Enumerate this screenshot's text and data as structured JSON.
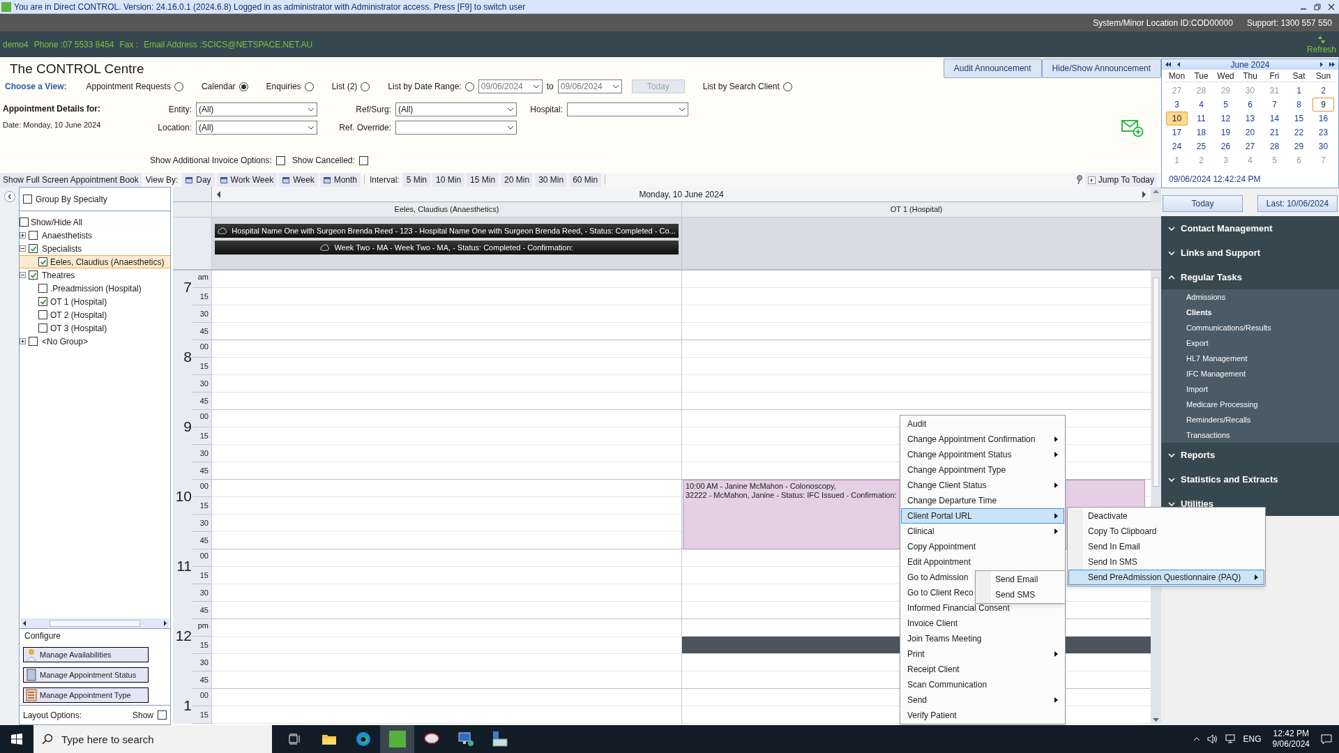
{
  "titlebar": {
    "text": "You are in Direct CONTROL. Version: 24.16.0.1 (2024.6.8) Logged in as administrator with Administrator access. Press [F9] to switch user"
  },
  "system_bar": {
    "location": "System/Minor Location ID:COD00000",
    "support": "Support: 1300 557 550"
  },
  "info_bar": {
    "parts": [
      "demo4",
      "Phone :07 5533 8454",
      "Fax :",
      "Email Address :SCICS@NETSPACE.NET.AU"
    ],
    "refresh": "Refresh"
  },
  "header": {
    "title": "The CONTROL Centre",
    "buttons": [
      "Audit Announcement",
      "Hide/Show Announcement"
    ]
  },
  "view_chooser": {
    "label": "Choose a View:",
    "options": [
      {
        "kind": "radio",
        "label": "Appointment Requests",
        "selected": false
      },
      {
        "kind": "radio",
        "label": "Calendar",
        "selected": true
      },
      {
        "kind": "radio",
        "label": "Enquiries",
        "selected": false
      },
      {
        "kind": "radio",
        "label": "List (2)",
        "selected": false
      },
      {
        "kind": "date_range",
        "label": "List by Date Range:",
        "selected": false,
        "from": "09/06/2024",
        "to_label": "to",
        "to": "09/06/2024",
        "today": "Today"
      },
      {
        "kind": "radio",
        "label": "List by Search Client",
        "selected": false
      }
    ]
  },
  "details": {
    "heading": "Appointment Details for:",
    "date": "Date: Monday, 10 June 2024",
    "filters": [
      {
        "label": "Entity:",
        "value": "(All)"
      },
      {
        "label": "Ref/Surg:",
        "value": "(All)"
      },
      {
        "label": "Hospital:"
      },
      {
        "label": "Location:",
        "value": "(All)"
      },
      {
        "label": "Ref. Override:"
      }
    ]
  },
  "options": [
    {
      "label": "Show Additional Invoice Options:",
      "checked": false
    },
    {
      "label": "Show Cancelled:",
      "checked": false
    }
  ],
  "toolbar": {
    "full_screen": "Show Full Screen Appointment Book",
    "view_by_label": "View By:",
    "views": [
      "Day",
      "Work Week",
      "Week",
      "Month"
    ],
    "interval_label": "Interval:",
    "intervals": [
      "5 Min",
      "10 Min",
      "15 Min",
      "20 Min",
      "30 Min",
      "60 Min"
    ],
    "jump": "Jump To Today"
  },
  "resource_panel": {
    "group_by": {
      "label": "Group By Specialty",
      "checked": false
    },
    "show_hide_all": {
      "label": "Show/Hide All",
      "checked": false
    },
    "tree": [
      {
        "label": "Anaesthetists",
        "checked": false,
        "expanded": false,
        "selected": false
      },
      {
        "label": "Specialists",
        "checked": true,
        "expanded": true,
        "selected": false,
        "children": [
          {
            "label": "Eeles, Claudius (Anaesthetics)",
            "checked": true,
            "selected": true
          }
        ]
      },
      {
        "label": "Theatres",
        "checked": true,
        "expanded": true,
        "selected": false,
        "children": [
          {
            "label": ".Preadmission (Hospital)",
            "checked": false,
            "selected": false
          },
          {
            "label": "OT 1 (Hospital)",
            "checked": true,
            "selected": false
          },
          {
            "label": "OT 2 (Hospital)",
            "checked": false,
            "selected": false
          },
          {
            "label": "OT 3 (Hospital)",
            "checked": false,
            "selected": false
          }
        ]
      },
      {
        "label": "<No Group>",
        "checked": false,
        "expanded": false,
        "selected": false
      }
    ]
  },
  "configure": {
    "title": "Configure",
    "buttons": [
      "Manage Availabilities",
      "Manage Appointment Status",
      "Manage Appointment Type"
    ],
    "layout_options": "Layout Options:",
    "show": {
      "label": "Show",
      "checked": false
    }
  },
  "calendar": {
    "date": "Monday, 10 June 2024",
    "columns": [
      {
        "name": "Eeles, Claudius (Anaesthetics)",
        "all_day": [
          "Hospital Name One with Surgeon Brenda Reed - 123 - Hospital Name One with Surgeon Brenda Reed,  - Status: Completed - Co...",
          "Week Two - MA - Week Two - MA,  - Status: Completed - Confirmation:"
        ]
      },
      {
        "name": "OT 1 (Hospital)",
        "appointments": [
          {
            "lines": [
              "10:00 AM - Janine McMahon - Colonoscopy,",
              "32222 - McMahon, Janine - Status: IFC Issued - Confirmation:"
            ]
          }
        ]
      }
    ],
    "hours": [
      {
        "hour": "7",
        "first": "am",
        "minutes": [
          "15",
          "30",
          "45"
        ]
      },
      {
        "hour": "8",
        "first": "00",
        "minutes": [
          "15",
          "30",
          "45"
        ]
      },
      {
        "hour": "9",
        "first": "00",
        "minutes": [
          "15",
          "30",
          "45"
        ]
      },
      {
        "hour": "10",
        "first": "00",
        "minutes": [
          "15",
          "30",
          "45"
        ]
      },
      {
        "hour": "11",
        "first": "00",
        "minutes": [
          "15",
          "30",
          "45"
        ]
      },
      {
        "hour": "12",
        "first": "pm",
        "minutes": [
          "15",
          "30",
          "45"
        ]
      },
      {
        "hour": "1",
        "first": "00",
        "minutes": [
          "15"
        ]
      }
    ]
  },
  "mini_calendar": {
    "month": "June 2024",
    "weekdays": [
      "Mon",
      "Tue",
      "Wed",
      "Thu",
      "Fri",
      "Sat",
      "Sun"
    ],
    "days": [
      {
        "d": "27",
        "muted": true,
        "selected": false,
        "today": false
      },
      {
        "d": "28",
        "muted": true,
        "selected": false,
        "today": false
      },
      {
        "d": "29",
        "muted": true,
        "selected": false,
        "today": false
      },
      {
        "d": "30",
        "muted": true,
        "selected": false,
        "today": false
      },
      {
        "d": "31",
        "muted": true,
        "selected": false,
        "today": false
      },
      {
        "d": "1",
        "muted": false,
        "selected": false,
        "today": false
      },
      {
        "d": "2",
        "muted": false,
        "selected": false,
        "today": false
      },
      {
        "d": "3",
        "muted": false,
        "selected": false,
        "today": false
      },
      {
        "d": "4",
        "muted": false,
        "selected": false,
        "today": false
      },
      {
        "d": "5",
        "muted": false,
        "selected": false,
        "today": false
      },
      {
        "d": "6",
        "muted": false,
        "selected": false,
        "today": false
      },
      {
        "d": "7",
        "muted": false,
        "selected": false,
        "today": false
      },
      {
        "d": "8",
        "muted": false,
        "selected": false,
        "today": false
      },
      {
        "d": "9",
        "muted": false,
        "selected": false,
        "today": true
      },
      {
        "d": "10",
        "muted": false,
        "selected": true,
        "today": false
      },
      {
        "d": "11",
        "muted": false,
        "selected": false,
        "today": false
      },
      {
        "d": "12",
        "muted": false,
        "selected": false,
        "today": false
      },
      {
        "d": "13",
        "muted": false,
        "selected": false,
        "today": false
      },
      {
        "d": "14",
        "muted": false,
        "selected": false,
        "today": false
      },
      {
        "d": "15",
        "muted": false,
        "selected": false,
        "today": false
      },
      {
        "d": "16",
        "muted": false,
        "selected": false,
        "today": false
      },
      {
        "d": "17",
        "muted": false,
        "selected": false,
        "today": false
      },
      {
        "d": "18",
        "muted": false,
        "selected": false,
        "today": false
      },
      {
        "d": "19",
        "muted": false,
        "selected": false,
        "today": false
      },
      {
        "d": "20",
        "muted": false,
        "selected": false,
        "today": false
      },
      {
        "d": "21",
        "muted": false,
        "selected": false,
        "today": false
      },
      {
        "d": "22",
        "muted": false,
        "selected": false,
        "today": false
      },
      {
        "d": "23",
        "muted": false,
        "selected": false,
        "today": false
      },
      {
        "d": "24",
        "muted": false,
        "selected": false,
        "today": false
      },
      {
        "d": "25",
        "muted": false,
        "selected": false,
        "today": false
      },
      {
        "d": "26",
        "muted": false,
        "selected": false,
        "today": false
      },
      {
        "d": "27",
        "muted": false,
        "selected": false,
        "today": false
      },
      {
        "d": "28",
        "muted": false,
        "selected": false,
        "today": false
      },
      {
        "d": "29",
        "muted": false,
        "selected": false,
        "today": false
      },
      {
        "d": "30",
        "muted": false,
        "selected": false,
        "today": false
      },
      {
        "d": "1",
        "muted": true,
        "selected": false,
        "today": false
      },
      {
        "d": "2",
        "muted": true,
        "selected": false,
        "today": false
      },
      {
        "d": "3",
        "muted": true,
        "selected": false,
        "today": false
      },
      {
        "d": "4",
        "muted": true,
        "selected": false,
        "today": false
      },
      {
        "d": "5",
        "muted": true,
        "selected": false,
        "today": false
      },
      {
        "d": "6",
        "muted": true,
        "selected": false,
        "today": false
      },
      {
        "d": "7",
        "muted": true,
        "selected": false,
        "today": false
      }
    ],
    "now": "09/06/2024 12:42:24 PM",
    "buttons": [
      "Today",
      "Last: 10/06/2024"
    ]
  },
  "navigation": [
    {
      "title": "Contact Management",
      "expanded": false
    },
    {
      "title": "Links and Support",
      "expanded": false
    },
    {
      "title": "Regular Tasks",
      "expanded": true,
      "items": [
        {
          "label": "Admissions",
          "selected": false
        },
        {
          "label": "Clients",
          "selected": true
        },
        {
          "label": "Communications/Results",
          "selected": false
        },
        {
          "label": "Export",
          "selected": false
        },
        {
          "label": "HL7 Management",
          "selected": false
        },
        {
          "label": "IFC Management",
          "selected": false
        },
        {
          "label": "Import",
          "selected": false
        },
        {
          "label": "Medicare Processing",
          "selected": false
        },
        {
          "label": "Reminders/Recalls",
          "selected": false
        },
        {
          "label": "Transactions",
          "selected": false
        }
      ]
    },
    {
      "title": "Reports",
      "expanded": false
    },
    {
      "title": "Statistics and Extracts",
      "expanded": false
    },
    {
      "title": "Utilities",
      "expanded": false
    }
  ],
  "context_menu": {
    "items": [
      {
        "label": "Audit",
        "submenu": false,
        "selected": false
      },
      {
        "label": "Change Appointment Confirmation",
        "submenu": true,
        "selected": false
      },
      {
        "label": "Change Appointment Status",
        "submenu": true,
        "selected": false
      },
      {
        "label": "Change Appointment Type",
        "submenu": false,
        "selected": false
      },
      {
        "label": "Change Client Status",
        "submenu": true,
        "selected": false
      },
      {
        "label": "Change Departure Time",
        "submenu": false,
        "selected": false
      },
      {
        "label": "Client Portal URL",
        "submenu": true,
        "selected": true
      },
      {
        "label": "Clinical",
        "submenu": true,
        "selected": false
      },
      {
        "label": "Copy Appointment",
        "submenu": false,
        "selected": false
      },
      {
        "label": "Edit Appointment",
        "submenu": false,
        "selected": false
      },
      {
        "label": "Go to Admission",
        "submenu": false,
        "selected": false
      },
      {
        "label": "Go to Client Reco",
        "submenu": false,
        "selected": false
      },
      {
        "label": "Informed Financial Consent",
        "submenu": false,
        "selected": false
      },
      {
        "label": "Invoice Client",
        "submenu": false,
        "selected": false
      },
      {
        "label": "Join Teams Meeting",
        "submenu": false,
        "selected": false
      },
      {
        "label": "Print",
        "submenu": true,
        "selected": false
      },
      {
        "label": "Receipt Client",
        "submenu": false,
        "selected": false
      },
      {
        "label": "Scan Communication",
        "submenu": false,
        "selected": false
      },
      {
        "label": "Send",
        "submenu": true,
        "selected": false
      },
      {
        "label": "Verify Patient",
        "submenu": false,
        "selected": false
      }
    ]
  },
  "client_portal_submenu": {
    "items": [
      {
        "label": "Deactivate",
        "submenu": false,
        "selected": false
      },
      {
        "label": "Copy To Clipboard",
        "submenu": false,
        "selected": false
      },
      {
        "label": "Send In Email",
        "submenu": false,
        "selected": false
      },
      {
        "label": "Send In SMS",
        "submenu": false,
        "selected": false
      },
      {
        "label": "Send PreAdmission Questionnaire (PAQ)",
        "submenu": true,
        "selected": true
      }
    ]
  },
  "send_submenu": {
    "items": [
      "Send Email",
      "Send SMS"
    ]
  },
  "taskbar": {
    "search_placeholder": "Type here to search",
    "language": "ENG",
    "time": "12:42 PM",
    "date": "9/06/2024"
  }
}
